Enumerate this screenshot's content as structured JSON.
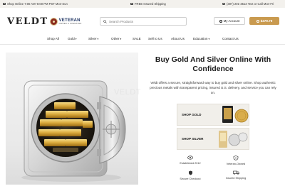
{
  "topbar": {
    "hours": "Shop Online 7:00 AM–8:00 PM PST Mon-Sun",
    "shipping": "FREE Insured Shipping",
    "phone": "(307) 201-3513 Text or Call Mon-Fri"
  },
  "header": {
    "logo": "VELDT",
    "veteran_title": "VETERAN",
    "veteran_sub": "OWNED & OPERATED",
    "search_placeholder": "Search Products",
    "account_label": "My Account",
    "cart_total": "$479.79"
  },
  "nav": {
    "items": [
      "Shop All",
      "Gold",
      "Silver",
      "Other",
      "SALE",
      "Sell to Us",
      "About Us",
      "Education",
      "Contact Us"
    ]
  },
  "hero": {
    "title": "Buy Gold And Silver Online With Confidence",
    "description": "Veldt offers a secure, straightforward way to buy gold and silver online. Shop authentic precious metals with transparent pricing, insured U.S. delivery, and service you can rely on.",
    "image_alt": "Open bank vault with gold bars"
  },
  "shop_cards": [
    {
      "label": "SHOP GOLD"
    },
    {
      "label": "SHOP SILVER"
    }
  ],
  "features": [
    {
      "label": "Established 2012",
      "icon": "eye-icon"
    },
    {
      "label": "Veteran-Owned",
      "icon": "shield-stars-icon"
    },
    {
      "label": "Secure Checkout",
      "icon": "lock-shield-icon"
    },
    {
      "label": "Insured Shipping",
      "icon": "truck-icon"
    }
  ],
  "colors": {
    "accent": "#c99a4f",
    "topbar_bg": "#f3f1ed",
    "card_bg": "#f1efea",
    "veteran_red": "#8b2b1e",
    "veteran_blue": "#1f3563"
  }
}
